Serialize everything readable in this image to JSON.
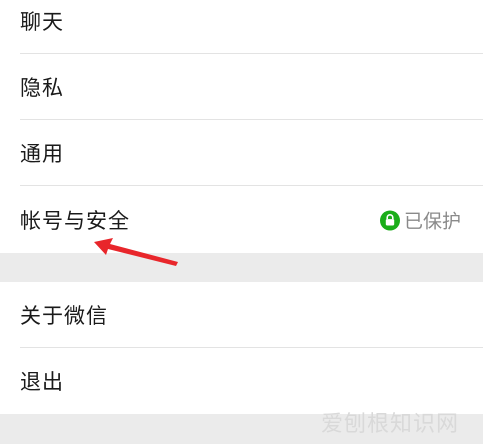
{
  "settings": {
    "items": [
      {
        "label": "聊天"
      },
      {
        "label": "隐私"
      },
      {
        "label": "通用"
      },
      {
        "label": "帐号与安全",
        "status": "已保护"
      }
    ],
    "items2": [
      {
        "label": "关于微信"
      },
      {
        "label": "退出"
      }
    ]
  },
  "colors": {
    "accent_green": "#1aad19",
    "annotation_red": "#e8262b"
  },
  "icons": {
    "lock": "lock-icon"
  },
  "watermark": "爱刨根知识网"
}
